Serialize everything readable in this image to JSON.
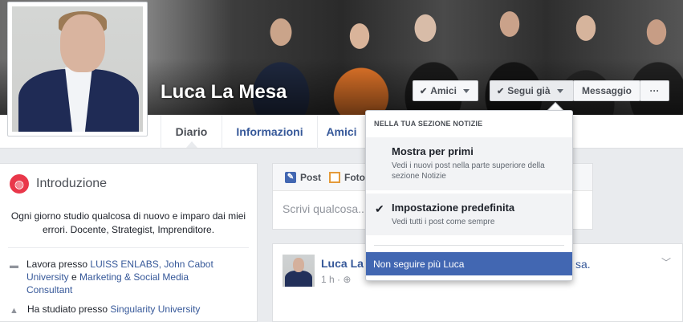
{
  "profile": {
    "name": "Luca La Mesa"
  },
  "cover_buttons": {
    "friends": "Amici",
    "following": "Segui già",
    "message": "Messaggio",
    "more": "···"
  },
  "nav": {
    "tabs": [
      "Diario",
      "Informazioni",
      "Amici"
    ]
  },
  "intro": {
    "title": "Introduzione",
    "bio": "Ogni giorno studio qualcosa di nuovo e imparo dai miei errori. Docente, Strategist, Imprenditore.",
    "work_prefix": "Lavora presso ",
    "work_link1": "LUISS ENLABS, John Cabot University",
    "work_and": " e ",
    "work_link2": "Marketing & Social Media Consultant",
    "study_prefix": "Ha studiato presso ",
    "study_link": "Singularity University"
  },
  "composer": {
    "tab_post": "Post",
    "tab_photo": "Foto",
    "placeholder": "Scrivi qualcosa..."
  },
  "post": {
    "author": "Luca La",
    "author_tail": "sa.",
    "time": "1 h · "
  },
  "dropdown": {
    "header": "NELLA TUA SEZIONE NOTIZIE",
    "option1_title": "Mostra per primi",
    "option1_desc": "Vedi i nuovi post nella parte superiore della sezione Notizie",
    "option2_title": "Impostazione predefinita",
    "option2_desc": "Vedi tutti i post come sempre",
    "unfollow": "Non seguire più Luca"
  },
  "colors": {
    "brand": "#4267b2",
    "link": "#365899",
    "intro_icon": "#e9374a"
  }
}
